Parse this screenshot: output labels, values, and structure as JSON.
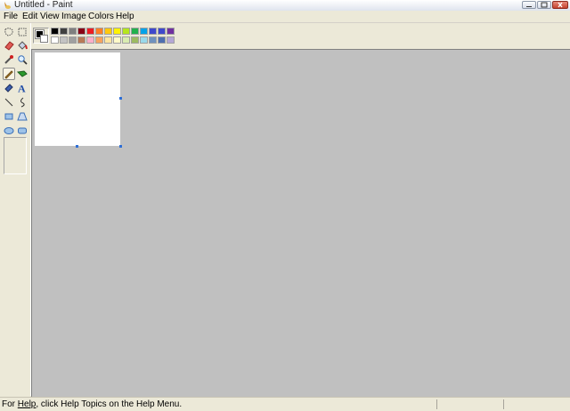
{
  "window": {
    "title": "Untitled - Paint",
    "minimize_icon": "minimize-icon",
    "maximize_icon": "restore-icon",
    "close_icon": "close-icon"
  },
  "menu": {
    "items": [
      "File",
      "Edit",
      "View",
      "Image",
      "Colors",
      "Help"
    ]
  },
  "toolbox": {
    "tools": [
      {
        "name": "free-form-select",
        "icon": "free-select-icon"
      },
      {
        "name": "rect-select",
        "icon": "rect-select-icon"
      },
      {
        "name": "eraser",
        "icon": "eraser-icon"
      },
      {
        "name": "fill",
        "icon": "paint-bucket-icon"
      },
      {
        "name": "pick-color",
        "icon": "eyedropper-icon"
      },
      {
        "name": "magnifier",
        "icon": "magnifier-icon"
      },
      {
        "name": "pencil",
        "icon": "pencil-icon",
        "active": true
      },
      {
        "name": "brush",
        "icon": "brush-icon"
      },
      {
        "name": "airbrush",
        "icon": "airbrush-icon"
      },
      {
        "name": "text",
        "icon": "text-icon"
      },
      {
        "name": "line",
        "icon": "line-icon"
      },
      {
        "name": "curve",
        "icon": "curve-icon"
      },
      {
        "name": "rectangle",
        "icon": "rectangle-icon"
      },
      {
        "name": "polygon",
        "icon": "polygon-icon"
      },
      {
        "name": "ellipse",
        "icon": "ellipse-icon"
      },
      {
        "name": "rounded-rectangle",
        "icon": "rounded-rect-icon"
      }
    ],
    "text_tool_glyph": "A"
  },
  "colors": {
    "foreground": "#000000",
    "background": "#ffffff",
    "palette_row1": [
      "#000000",
      "#404040",
      "#7f7f7f",
      "#880015",
      "#ed1c24",
      "#ff7f27",
      "#ffc90e",
      "#fff200",
      "#b5e61d",
      "#22b14c",
      "#00a2e8",
      "#3f48cc",
      "#3f48cc",
      "#7030a0"
    ],
    "palette_row2": [
      "#ffffff",
      "#c3c3c3",
      "#a0a0a0",
      "#b97a57",
      "#ffaec9",
      "#f7a35c",
      "#ffe6a0",
      "#fffac8",
      "#d9ecb0",
      "#9dbb61",
      "#99d9ea",
      "#7092be",
      "#4f6fb0",
      "#b4a7d6"
    ]
  },
  "status": {
    "help_prefix": "For ",
    "help_link": "Help",
    "help_suffix": ", click Help Topics on the Help Menu."
  }
}
